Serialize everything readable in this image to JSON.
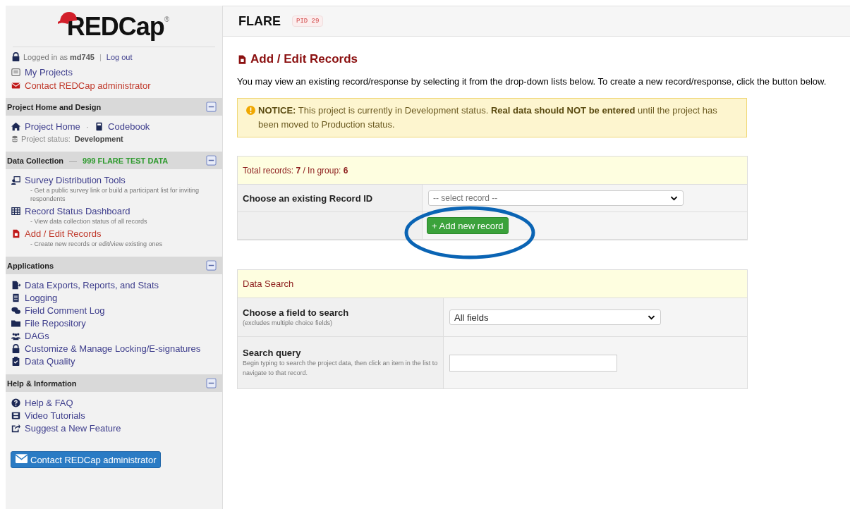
{
  "sidebar": {
    "logo": {
      "text": "REDCap",
      "mark": "®"
    },
    "login": {
      "prefix": "Logged in as",
      "user": "md745",
      "separator": "|",
      "logout": "Log out"
    },
    "links": [
      {
        "label": "My Projects",
        "kind": "link"
      },
      {
        "label": "Contact REDCap administrator",
        "kind": "alert"
      }
    ],
    "sections": [
      {
        "title": "Project Home and Design",
        "expanded": true,
        "inline_items": [
          {
            "label": "Project Home"
          },
          {
            "label": "Codebook"
          }
        ],
        "inline_separator": "·",
        "status": {
          "label": "Project status:",
          "value": "Development"
        }
      },
      {
        "title": "Data Collection",
        "dash": "—",
        "badge": "999 FLARE TEST DATA",
        "expanded": true,
        "items": [
          {
            "label": "Survey Distribution Tools",
            "description": "- Get a public survey link or build a participant list for inviting respondents",
            "selected": false
          },
          {
            "label": "Record Status Dashboard",
            "description": "- View data collection status of all records",
            "selected": false
          },
          {
            "label": "Add / Edit Records",
            "description": "- Create new records or edit/view existing ones",
            "selected": true
          }
        ]
      },
      {
        "title": "Applications",
        "expanded": true,
        "items": [
          {
            "label": "Data Exports, Reports, and Stats",
            "selected": false
          },
          {
            "label": "Logging",
            "selected": false
          },
          {
            "label": "Field Comment Log",
            "selected": false
          },
          {
            "label": "File Repository",
            "selected": false
          },
          {
            "label": "DAGs",
            "selected": false
          },
          {
            "label": "Customize & Manage Locking/E-signatures",
            "selected": false
          },
          {
            "label": "Data Quality",
            "selected": false
          }
        ]
      },
      {
        "title": "Help & Information",
        "expanded": true,
        "items": [
          {
            "label": "Help & FAQ",
            "selected": false
          },
          {
            "label": "Video Tutorials",
            "selected": false
          },
          {
            "label": "Suggest a New Feature",
            "selected": false
          }
        ]
      }
    ],
    "contact_button": "Contact REDCap administrator"
  },
  "header": {
    "project": "FLARE",
    "pid": "PID 29"
  },
  "page": {
    "title": "Add / Edit Records",
    "intro": "You may view an existing record/response by selecting it from the drop-down lists below. To create a new record/response, click the button below.",
    "notice": "**NOTICE:** This project is currently in Development status. **Real data should NOT be entered** until the project has been moved to Production status.",
    "records": {
      "summary": "Total records: **7**  /  In group: **6**",
      "choose_label": "Choose an existing Record ID",
      "select_value": "-- select record --",
      "add_button": "+ Add new record"
    },
    "annotation": {
      "kind": "ellipse"
    },
    "search": {
      "title": "Data Search",
      "field_label": "Choose a field to search",
      "field_note": "(excludes multiple choice fields)",
      "field_value": "All fields",
      "query_label": "Search query",
      "query_note": "Begin typing to search the project data, then click an item in the list to navigate to that record."
    }
  }
}
